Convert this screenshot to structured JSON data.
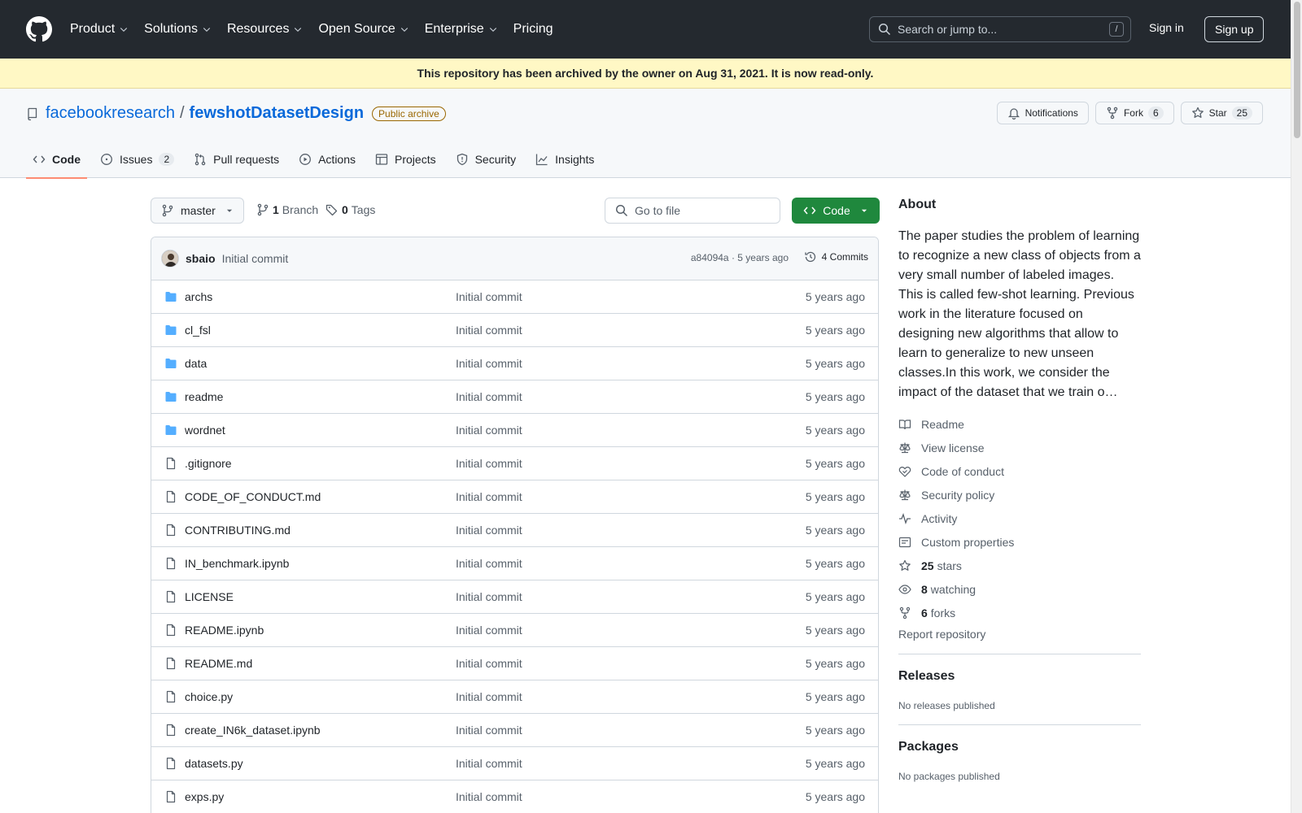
{
  "header": {
    "nav": [
      {
        "label": "Product",
        "has_chevron": true
      },
      {
        "label": "Solutions",
        "has_chevron": true
      },
      {
        "label": "Resources",
        "has_chevron": true
      },
      {
        "label": "Open Source",
        "has_chevron": true
      },
      {
        "label": "Enterprise",
        "has_chevron": true
      },
      {
        "label": "Pricing",
        "has_chevron": false
      }
    ],
    "search_placeholder": "Search or jump to...",
    "search_shortcut": "/",
    "sign_in": "Sign in",
    "sign_up": "Sign up"
  },
  "banner": {
    "text": "This repository has been archived by the owner on Aug 31, 2021. It is now read-only."
  },
  "repo": {
    "owner": "facebookresearch",
    "separator": "/",
    "name": "fewshotDatasetDesign",
    "visibility": "Public archive",
    "notifications": "Notifications",
    "fork_label": "Fork",
    "fork_count": "6",
    "star_label": "Star",
    "star_count": "25"
  },
  "tabs": [
    {
      "label": "Code",
      "active": true,
      "icon": "code-icon"
    },
    {
      "label": "Issues",
      "counter": "2",
      "icon": "issue-icon"
    },
    {
      "label": "Pull requests",
      "icon": "pull-request-icon"
    },
    {
      "label": "Actions",
      "icon": "play-icon"
    },
    {
      "label": "Projects",
      "icon": "table-icon"
    },
    {
      "label": "Security",
      "icon": "shield-icon"
    },
    {
      "label": "Insights",
      "icon": "graph-icon"
    }
  ],
  "toolbar": {
    "branch": "master",
    "branch_count": "1",
    "branch_label": "Branch",
    "tag_count": "0",
    "tag_label": "Tags",
    "goto_placeholder": "Go to file",
    "code_button": "Code"
  },
  "latest_commit": {
    "author": "sbaio",
    "message": "Initial commit",
    "hash": "a84094a",
    "dot": "·",
    "age": "5 years ago",
    "commits": "4 Commits"
  },
  "files": [
    {
      "name": "archs",
      "type": "dir",
      "message": "Initial commit",
      "age": "5 years ago"
    },
    {
      "name": "cl_fsl",
      "type": "dir",
      "message": "Initial commit",
      "age": "5 years ago"
    },
    {
      "name": "data",
      "type": "dir",
      "message": "Initial commit",
      "age": "5 years ago"
    },
    {
      "name": "readme",
      "type": "dir",
      "message": "Initial commit",
      "age": "5 years ago"
    },
    {
      "name": "wordnet",
      "type": "dir",
      "message": "Initial commit",
      "age": "5 years ago"
    },
    {
      "name": ".gitignore",
      "type": "file",
      "message": "Initial commit",
      "age": "5 years ago"
    },
    {
      "name": "CODE_OF_CONDUCT.md",
      "type": "file",
      "message": "Initial commit",
      "age": "5 years ago"
    },
    {
      "name": "CONTRIBUTING.md",
      "type": "file",
      "message": "Initial commit",
      "age": "5 years ago"
    },
    {
      "name": "IN_benchmark.ipynb",
      "type": "file",
      "message": "Initial commit",
      "age": "5 years ago"
    },
    {
      "name": "LICENSE",
      "type": "file",
      "message": "Initial commit",
      "age": "5 years ago"
    },
    {
      "name": "README.ipynb",
      "type": "file",
      "message": "Initial commit",
      "age": "5 years ago"
    },
    {
      "name": "README.md",
      "type": "file",
      "message": "Initial commit",
      "age": "5 years ago"
    },
    {
      "name": "choice.py",
      "type": "file",
      "message": "Initial commit",
      "age": "5 years ago"
    },
    {
      "name": "create_IN6k_dataset.ipynb",
      "type": "file",
      "message": "Initial commit",
      "age": "5 years ago"
    },
    {
      "name": "datasets.py",
      "type": "file",
      "message": "Initial commit",
      "age": "5 years ago"
    },
    {
      "name": "exps.py",
      "type": "file",
      "message": "Initial commit",
      "age": "5 years ago"
    }
  ],
  "about": {
    "title": "About",
    "description": "The paper studies the problem of learning to recognize a new class of objects from a very small number of labeled images. This is called few-shot learning. Previous work in the literature focused on designing new algorithms that allow to learn to generalize to new unseen classes.In this work, we consider the impact of the dataset that we train o…",
    "links": [
      {
        "icon": "book-icon",
        "label": "Readme"
      },
      {
        "icon": "law-icon",
        "label": "View license"
      },
      {
        "icon": "code-of-conduct-icon",
        "label": "Code of conduct"
      },
      {
        "icon": "law-icon",
        "label": "Security policy"
      },
      {
        "icon": "pulse-icon",
        "label": "Activity"
      },
      {
        "icon": "note-icon",
        "label": "Custom properties"
      },
      {
        "icon": "star-icon",
        "count": "25",
        "label": "stars"
      },
      {
        "icon": "eye-icon",
        "count": "8",
        "label": "watching"
      },
      {
        "icon": "fork-icon",
        "count": "6",
        "label": "forks"
      }
    ],
    "report": "Report repository"
  },
  "releases": {
    "title": "Releases",
    "empty": "No releases published"
  },
  "packages": {
    "title": "Packages",
    "empty": "No packages published"
  }
}
